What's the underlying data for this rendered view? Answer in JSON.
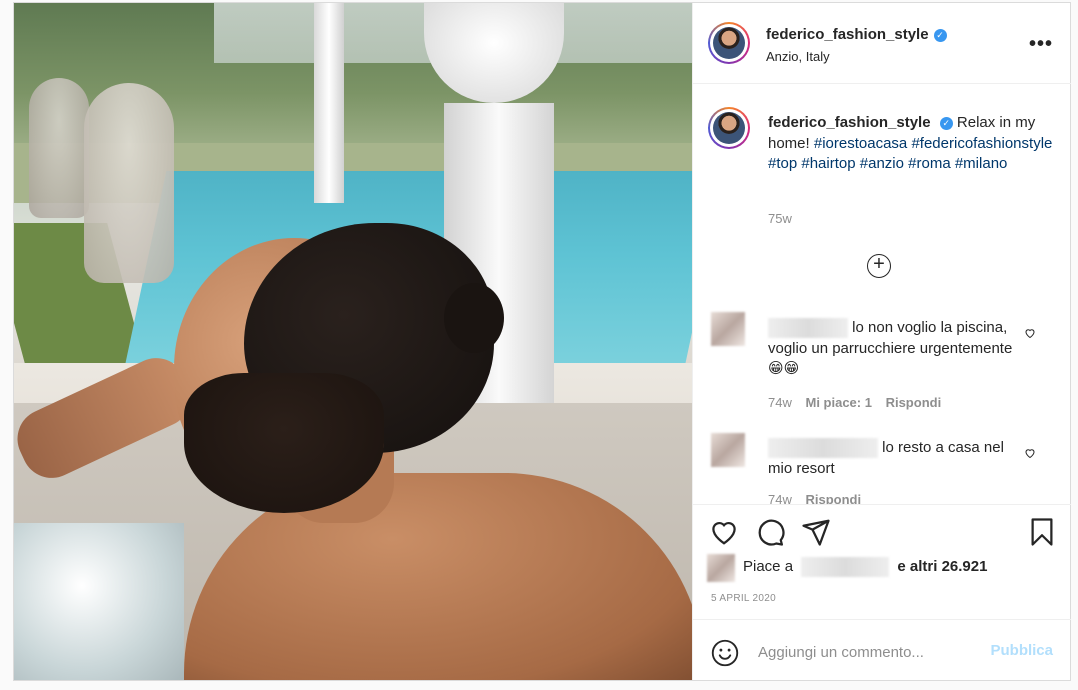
{
  "post": {
    "username": "federico_fashion_style",
    "location": "Anzio, Italy",
    "more_label": "•••",
    "caption": {
      "username": "federico_fashion_style",
      "text": "Relax in my home!",
      "hashtags": [
        "#iorestoacasa",
        "#federicofashionstyle",
        "#top",
        "#hairtop",
        "#anzio",
        "#roma",
        "#milano"
      ],
      "time": "75w"
    },
    "comments": [
      {
        "text": "lo non voglio la piscina, voglio un parrucchiere urgentemente 😁😁",
        "time": "74w",
        "likes": "Mi piace: 1",
        "reply": "Rispondi"
      },
      {
        "text": "lo resto a casa nel mio resort",
        "time": "74w",
        "reply": "Rispondi"
      }
    ],
    "likes": {
      "prefix": "Piace a",
      "suffix": "e altri 26.921"
    },
    "date": "5 APRIL 2020",
    "comment_input": {
      "placeholder": "Aggiungi un commento...",
      "post_label": "Pubblica"
    }
  },
  "colors": {
    "link": "#00376b",
    "verified": "#3897f0",
    "muted": "#8e8e8e",
    "post_button": "#b2dffc"
  }
}
